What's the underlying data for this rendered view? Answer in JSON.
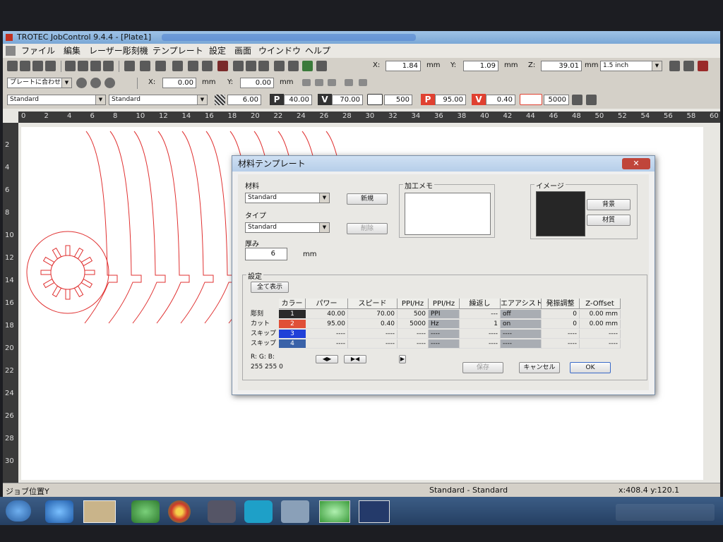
{
  "app": {
    "title": "TROTEC JobControl 9.4.4 - [Plate1]"
  },
  "menu": [
    "ファイル",
    "編集",
    "レーザー彫刻機",
    "テンプレート",
    "設定",
    "画面",
    "ウインドウ",
    "ヘルプ"
  ],
  "toolbar1": {
    "x_label": "X:",
    "x_value": "1.84",
    "y_label": "Y:",
    "y_value": "1.09",
    "z_label": "Z:",
    "z_value": "39.01",
    "unit": "mm",
    "lens": "1.5 inch"
  },
  "toolbar2": {
    "fit_select": "プレートに合わせ",
    "x_label": "X:",
    "x_value": "0.00",
    "y_label": "Y:",
    "y_value": "0.00",
    "unit": "mm"
  },
  "toolbar3": {
    "material_a": "Standard",
    "material_b": "Standard",
    "thickness": "6.00",
    "p1_label": "P",
    "p1_value": "40.00",
    "v1_label": "V",
    "v1_value": "70.00",
    "f1_value": "500",
    "p2_label": "P",
    "p2_value": "95.00",
    "v2_label": "V",
    "v2_value": "0.40",
    "f2_value": "5000"
  },
  "ruler_h": [
    "0",
    "2",
    "4",
    "6",
    "8",
    "10",
    "12",
    "14",
    "16",
    "18",
    "20",
    "22",
    "24",
    "26",
    "28",
    "30",
    "32",
    "34",
    "36",
    "38",
    "40",
    "42",
    "44",
    "46",
    "48",
    "50",
    "52",
    "54",
    "56",
    "58",
    "60"
  ],
  "ruler_v": [
    "2",
    "4",
    "6",
    "8",
    "10",
    "12",
    "14",
    "16",
    "18",
    "20",
    "22",
    "24",
    "26",
    "28",
    "30"
  ],
  "status": {
    "job_position": "ジョブ位置Y",
    "material": "Standard - Standard",
    "coords": "x:408.4   y:120.1"
  },
  "dialog": {
    "title": "材料テンプレート",
    "close": "✕",
    "material_label": "材料",
    "material_value": "Standard",
    "new_button": "新規",
    "type_label": "タイプ",
    "type_value": "Standard",
    "delete_button": "削除",
    "thickness_label": "厚み",
    "thickness_value": "6",
    "thickness_unit": "mm",
    "memo_label": "加工メモ",
    "image_label": "イメージ",
    "background_button": "背景",
    "material_button": "材質",
    "settings_label": "設定",
    "show_all_button": "全て表示",
    "headers": [
      "カラー",
      "パワー",
      "スピード",
      "PPI/Hz",
      "PPI/Hz",
      "繰返し",
      "エアアシスト",
      "発振調整",
      "Z-Offset"
    ],
    "rows": [
      {
        "name": "彫刻",
        "num": "1",
        "color": "#2a2a2a",
        "power": "40.00",
        "speed": "70.00",
        "freq": "500",
        "mode": "PPI",
        "repeat": "---",
        "air": "off",
        "osc": "0",
        "zoff": "0.00 mm"
      },
      {
        "name": "カット",
        "num": "2",
        "color": "#e05038",
        "power": "95.00",
        "speed": "0.40",
        "freq": "5000",
        "mode": "Hz",
        "repeat": "1",
        "air": "on",
        "osc": "0",
        "zoff": "0.00 mm"
      },
      {
        "name": "スキップ",
        "num": "3",
        "color": "#2040d8",
        "power": "----",
        "speed": "----",
        "freq": "----",
        "mode": "----",
        "repeat": "----",
        "air": "----",
        "osc": "----",
        "zoff": "----"
      },
      {
        "name": "スキップ",
        "num": "4",
        "color": "#3a62a8",
        "power": "----",
        "speed": "----",
        "freq": "----",
        "mode": "----",
        "repeat": "----",
        "air": "----",
        "osc": "----",
        "zoff": "----"
      }
    ],
    "rgb_label": "R:   G:   B:",
    "rgb_value": "255  255   0",
    "save_button": "保存",
    "cancel_button": "キャンセル",
    "ok_button": "OK"
  },
  "colors": {
    "accent_red": "#e05038",
    "cut_line": "#e03030"
  }
}
